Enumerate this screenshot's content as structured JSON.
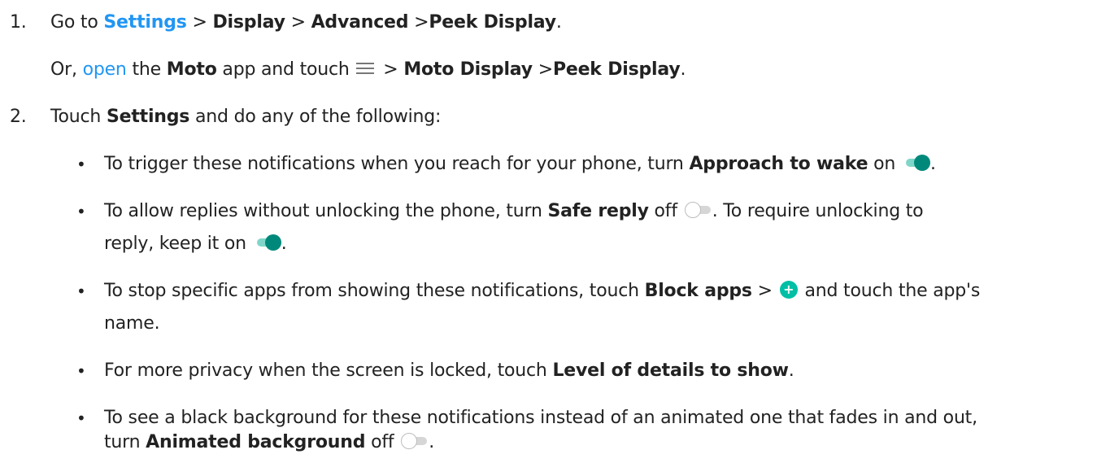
{
  "step1": {
    "number": "1.",
    "go_to": "Go to",
    "settings_link": "Settings",
    "sep": ">",
    "display": "Display",
    "advanced": "Advanced",
    "peek_display": "Peek Display",
    "end": "."
  },
  "step1_alt": {
    "or": "Or,",
    "open_link": "open",
    "the": "the",
    "moto": "Moto",
    "app_touch": "app and touch",
    "menu_icon": "menu-icon",
    "moto_display": "Moto Display",
    "peek_display": "Peek Display",
    "end": "."
  },
  "step2": {
    "number": "2.",
    "touch": "Touch",
    "settings": "Settings",
    "rest": "and do any of the following:"
  },
  "bullets": {
    "symbol": "•",
    "b1": {
      "pre": "To trigger these notifications when you reach for your phone, turn",
      "bold": "Approach to wake",
      "post": "on",
      "end": "."
    },
    "b2": {
      "pre": "To allow replies without unlocking the phone, turn",
      "bold": "Safe reply",
      "post": "off",
      "mid": ". To require unlocking to",
      "line2": "reply, keep it on",
      "end": "."
    },
    "b3": {
      "pre": "To stop specific apps from showing these notifications, touch",
      "bold": "Block apps",
      "sep": ">",
      "post": "and touch the app's",
      "line2": "name."
    },
    "b4": {
      "pre": "For more privacy when the screen is locked, touch",
      "bold": "Level of details to show",
      "end": "."
    },
    "b5": {
      "pre": "To see a black background for these notifications instead of an animated one that fades in and out,",
      "line2_pre": "turn",
      "bold": "Animated background",
      "post": "off",
      "end": "."
    }
  },
  "colors": {
    "link": "#2196f3",
    "toggle_on": "#00897b",
    "plus_button": "#00bfa5"
  }
}
